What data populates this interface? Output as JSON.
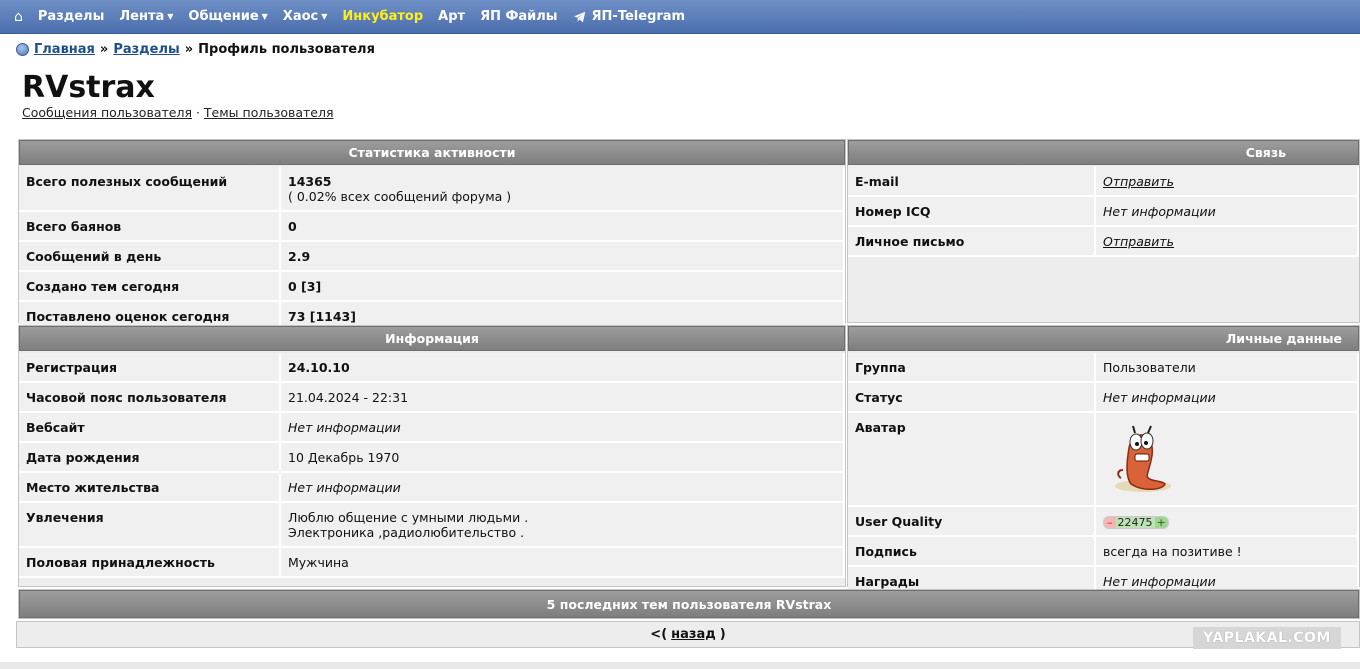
{
  "nav": {
    "home_icon": "home-icon",
    "items": [
      {
        "label": "Разделы",
        "dropdown": false,
        "highlight": false
      },
      {
        "label": "Лента",
        "dropdown": true,
        "highlight": false
      },
      {
        "label": "Общение",
        "dropdown": true,
        "highlight": false
      },
      {
        "label": "Хаос",
        "dropdown": true,
        "highlight": false
      },
      {
        "label": "Инкубатор",
        "dropdown": false,
        "highlight": true
      },
      {
        "label": "Арт",
        "dropdown": false,
        "highlight": false
      },
      {
        "label": "ЯП Файлы",
        "dropdown": false,
        "highlight": false
      },
      {
        "label": "ЯП-Telegram",
        "dropdown": false,
        "highlight": false,
        "icon": "telegram-icon"
      }
    ],
    "highlight_color": "#ffef1a"
  },
  "breadcrumb": {
    "home": "Главная",
    "sections": "Разделы",
    "current": "Профиль пользователя",
    "sep": "»"
  },
  "profile": {
    "username": "RVstrax",
    "links": {
      "messages": "Сообщения пользователя",
      "dot": "·",
      "topics": "Темы пользователя"
    }
  },
  "stats": {
    "title": "Статистика активности",
    "rows": [
      {
        "key": "Всего полезных сообщений",
        "value": "14365",
        "sub": "( 0.02% всех сообщений форума )"
      },
      {
        "key": "Всего баянов",
        "value": "0"
      },
      {
        "key": "Сообщений в день",
        "value": "2.9"
      },
      {
        "key": "Создано тем сегодня",
        "value": "0 [3]"
      },
      {
        "key": "Поставлено оценок сегодня",
        "value": "73 [1143]"
      }
    ]
  },
  "contact": {
    "title": "Связь",
    "rows": [
      {
        "key": "E-mail",
        "value": "Отправить"
      },
      {
        "key": "Номер ICQ",
        "value": "Нет информации"
      },
      {
        "key": "Личное письмо",
        "value": "Отправить"
      }
    ]
  },
  "info": {
    "title": "Информация",
    "rows": [
      {
        "key": "Регистрация",
        "value": "24.10.10"
      },
      {
        "key": "Часовой пояс пользователя",
        "value": "21.04.2024 - 22:31"
      },
      {
        "key": "Вебсайт",
        "value": "Нет информации"
      },
      {
        "key": "Дата рождения",
        "value": "10 Декабрь 1970"
      },
      {
        "key": "Место жительства",
        "value": "Нет информации"
      },
      {
        "key": "Увлечения",
        "value_line1": "Люблю общение с умными людьми .",
        "value_line2": "Электроника ,радиолюбительство ."
      },
      {
        "key": "Половая принадлежность",
        "value": "Мужчина"
      }
    ]
  },
  "personal": {
    "title": "Личные данные",
    "rows": [
      {
        "key": "Группа",
        "value": "Пользователи"
      },
      {
        "key": "Статус",
        "value": "Нет информации"
      },
      {
        "key": "Аватар",
        "avatar_icon": "worm-avatar-icon"
      },
      {
        "key": "User Quality",
        "minus": "–",
        "value": "22475",
        "plus": "+"
      },
      {
        "key": "Подпись",
        "value": "всегда на позитиве !"
      },
      {
        "key": "Награды",
        "value": "Нет информации"
      }
    ]
  },
  "recent": {
    "title": "5 последних тем пользователя RVstrax",
    "back_prefix": "<(",
    "back_link": "назад",
    "back_suffix": ")"
  },
  "watermark": "YAPLAKAL.COM"
}
